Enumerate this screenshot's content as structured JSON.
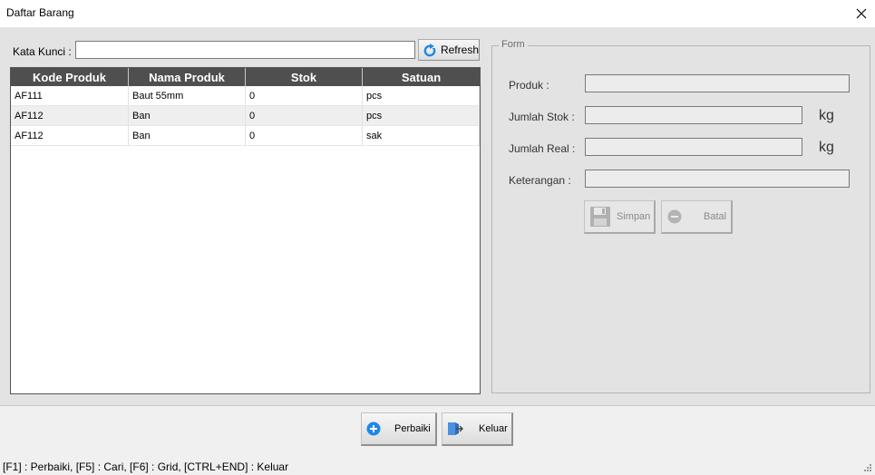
{
  "window": {
    "title": "Daftar Barang"
  },
  "search": {
    "label": "Kata Kunci :",
    "value": "",
    "refresh_label": "Refresh"
  },
  "grid": {
    "columns": [
      "Kode Produk",
      "Nama Produk",
      "Stok",
      "Satuan"
    ],
    "rows": [
      [
        "AF111",
        "Baut 55mm",
        "0",
        "pcs"
      ],
      [
        "AF112",
        "Ban",
        "0",
        "pcs"
      ],
      [
        "AF112",
        "Ban",
        "0",
        "sak"
      ]
    ]
  },
  "form": {
    "legend": "Form",
    "produk_label": "Produk :",
    "produk_value": "",
    "jumlah_stok_label": "Jumlah Stok :",
    "jumlah_stok_value": "",
    "jumlah_stok_unit": "kg",
    "jumlah_real_label": "Jumlah Real :",
    "jumlah_real_value": "",
    "jumlah_real_unit": "kg",
    "keterangan_label": "Keterangan :",
    "keterangan_value": "",
    "simpan_label": "Simpan",
    "batal_label": "Batal"
  },
  "actions": {
    "perbaiki_label": "Perbaiki",
    "keluar_label": "Keluar"
  },
  "statusbar": {
    "text": "[F1] : Perbaiki,    [F5] : Cari,    [F6] : Grid,    [CTRL+END] : Keluar"
  },
  "colors": {
    "grid_header": "#4f4f4f",
    "accent_blue": "#1e88e5"
  }
}
